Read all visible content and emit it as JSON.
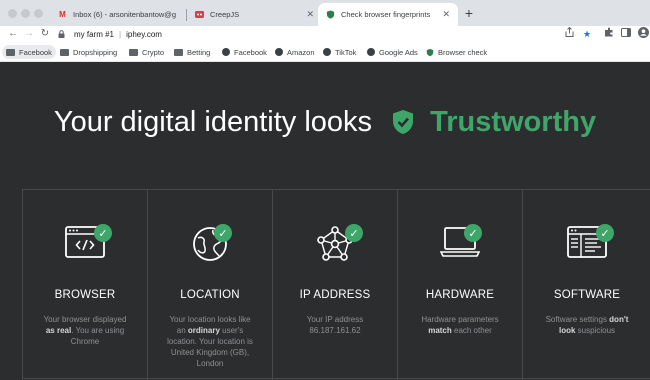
{
  "browser": {
    "tabs": [
      {
        "label": "Inbox (6) - arsonitenbantow@g",
        "icon": "gmail-icon",
        "active": false
      },
      {
        "label": "CreepJS",
        "icon": "creepjs-icon",
        "active": false
      },
      {
        "label": "Check browser fingerprints",
        "icon": "shield-icon",
        "active": true
      }
    ],
    "address": {
      "profile": "my farm #1",
      "url": "iphey.com"
    },
    "bookmarks": [
      {
        "label": "Facebook",
        "icon": "folder-icon"
      },
      {
        "label": "Dropshipping",
        "icon": "folder-icon"
      },
      {
        "label": "Crypto",
        "icon": "folder-icon"
      },
      {
        "label": "Betting",
        "icon": "folder-icon"
      },
      {
        "label": "Facebook",
        "icon": "globe-icon"
      },
      {
        "label": "Amazon",
        "icon": "globe-icon"
      },
      {
        "label": "TikTok",
        "icon": "globe-icon"
      },
      {
        "label": "Google Ads",
        "icon": "globe-icon"
      },
      {
        "label": "Browser check",
        "icon": "shield-icon"
      }
    ]
  },
  "hero": {
    "prefix": "Your digital identity looks",
    "status": "Trustworthy"
  },
  "colors": {
    "accent": "#3fa66a",
    "background": "#2c2d2f"
  },
  "cards": [
    {
      "title": "BROWSER",
      "icon": "code-window-icon",
      "desc": [
        {
          "t": "Your browser displayed "
        },
        {
          "t": "as real",
          "b": true
        },
        {
          "t": ". You are using Chrome"
        }
      ]
    },
    {
      "title": "LOCATION",
      "icon": "globe-icon",
      "desc": [
        {
          "t": "Your location looks like an "
        },
        {
          "t": "ordinary",
          "b": true
        },
        {
          "t": " user's location. Your location is United Kingdom (GB), London"
        }
      ]
    },
    {
      "title": "IP ADDRESS",
      "icon": "network-icon",
      "desc": [
        {
          "t": "Your IP address 86.187.161.62"
        }
      ]
    },
    {
      "title": "HARDWARE",
      "icon": "laptop-icon",
      "desc": [
        {
          "t": "Hardware parameters "
        },
        {
          "t": "match",
          "b": true
        },
        {
          "t": " each other"
        }
      ]
    },
    {
      "title": "SOFTWARE",
      "icon": "software-window-icon",
      "desc": [
        {
          "t": "Software settings "
        },
        {
          "t": "don't look",
          "b": true
        },
        {
          "t": " suspicious"
        }
      ]
    }
  ]
}
